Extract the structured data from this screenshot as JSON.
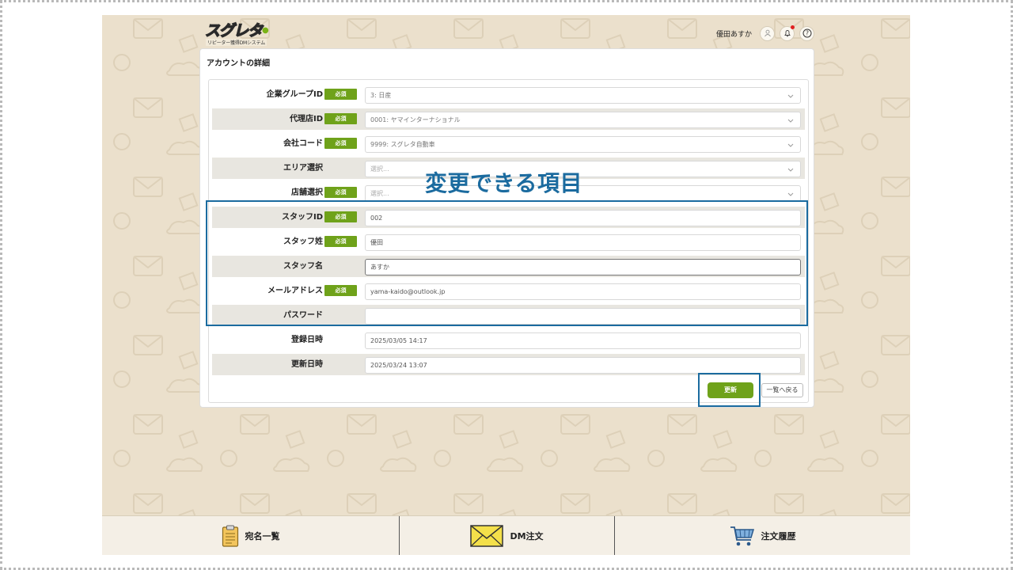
{
  "header": {
    "logo_main": "スグレタ",
    "logo_sub": "リピーター獲得DMシステム",
    "user_name": "優田あすか"
  },
  "page": {
    "title": "アカウントの詳細"
  },
  "form": {
    "rows": [
      {
        "label": "企業グループID",
        "required": true,
        "value": "3: 日産",
        "type": "select"
      },
      {
        "label": "代理店ID",
        "required": true,
        "value": "0001: ヤマインターナショナル",
        "type": "select"
      },
      {
        "label": "会社コード",
        "required": true,
        "value": "9999: スグレタ自動車",
        "type": "select"
      },
      {
        "label": "エリア選択",
        "required": false,
        "value": "選択...",
        "type": "select"
      },
      {
        "label": "店舗選択",
        "required": true,
        "value": "選択...",
        "type": "select"
      },
      {
        "label": "スタッフID",
        "required": true,
        "value": "002",
        "type": "text"
      },
      {
        "label": "スタッフ姓",
        "required": true,
        "value": "優田",
        "type": "text"
      },
      {
        "label": "スタッフ名",
        "required": false,
        "value": "あすか",
        "type": "text"
      },
      {
        "label": "メールアドレス",
        "required": true,
        "value": "yama-kaido@outlook.jp",
        "type": "text"
      },
      {
        "label": "パスワード",
        "required": false,
        "value": "",
        "type": "text"
      },
      {
        "label": "登録日時",
        "required": false,
        "value": "2025/03/05 14:17",
        "type": "text"
      },
      {
        "label": "更新日時",
        "required": false,
        "value": "2025/03/24 13:07",
        "type": "text"
      }
    ],
    "required_badge": "必須",
    "update_label": "更新",
    "back_label": "一覧へ戻る"
  },
  "annotation": {
    "text": "変更できる項目",
    "color": "#1b6b9f"
  },
  "bottom_nav": {
    "items": [
      {
        "label": "宛名一覧",
        "icon": "clipboard-icon"
      },
      {
        "label": "DM注文",
        "icon": "envelope-icon"
      },
      {
        "label": "注文履歴",
        "icon": "cart-icon"
      }
    ]
  },
  "colors": {
    "accent_green": "#6fa21a",
    "background_beige": "#ebe0cc",
    "highlight_blue": "#1b6b9f"
  }
}
